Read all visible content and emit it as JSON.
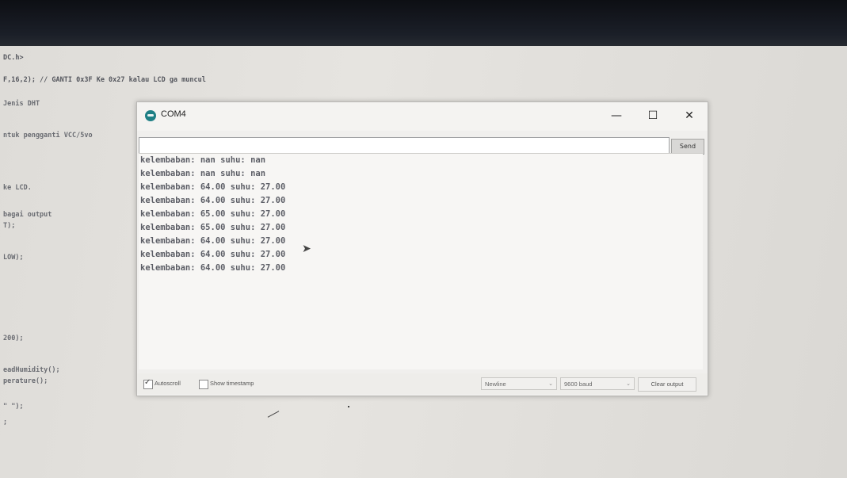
{
  "ide": {
    "header_lines": [
      "DC.h>",
      "F,16,2); // GANTI 0x3F Ke 0x27 kalau LCD ga muncul"
    ],
    "code_lines": [
      "Jenis DHT",
      "ntuk pengganti VCC/5vo",
      "ke LCD.",
      "bagai output",
      "T);",
      "LOW);",
      "200);",
      "eadHumidity();",
      "perature();",
      "\" \");",
      ";"
    ]
  },
  "window": {
    "title": "COM4",
    "minimize": "—",
    "maximize": "☐",
    "close": "✕",
    "send_label": "Send",
    "input_value": ""
  },
  "output_lines": [
    "kelembaban: nan suhu: nan",
    "kelembaban: nan suhu: nan",
    "kelembaban: 64.00 suhu: 27.00",
    "kelembaban: 64.00 suhu: 27.00",
    "kelembaban: 65.00 suhu: 27.00",
    "kelembaban: 65.00 suhu: 27.00",
    "kelembaban: 64.00 suhu: 27.00",
    "kelembaban: 64.00 suhu: 27.00",
    "kelembaban: 64.00 suhu: 27.00"
  ],
  "bottom": {
    "autoscroll_label": "Autoscroll",
    "autoscroll_checked": true,
    "timestamp_label": "Show timestamp",
    "timestamp_checked": false,
    "line_ending": "Newline",
    "baud": "9600 baud",
    "clear_label": "Clear output"
  },
  "colors": {
    "icon_teal": "#1e7f85",
    "text_gray": "#5c5e66"
  }
}
